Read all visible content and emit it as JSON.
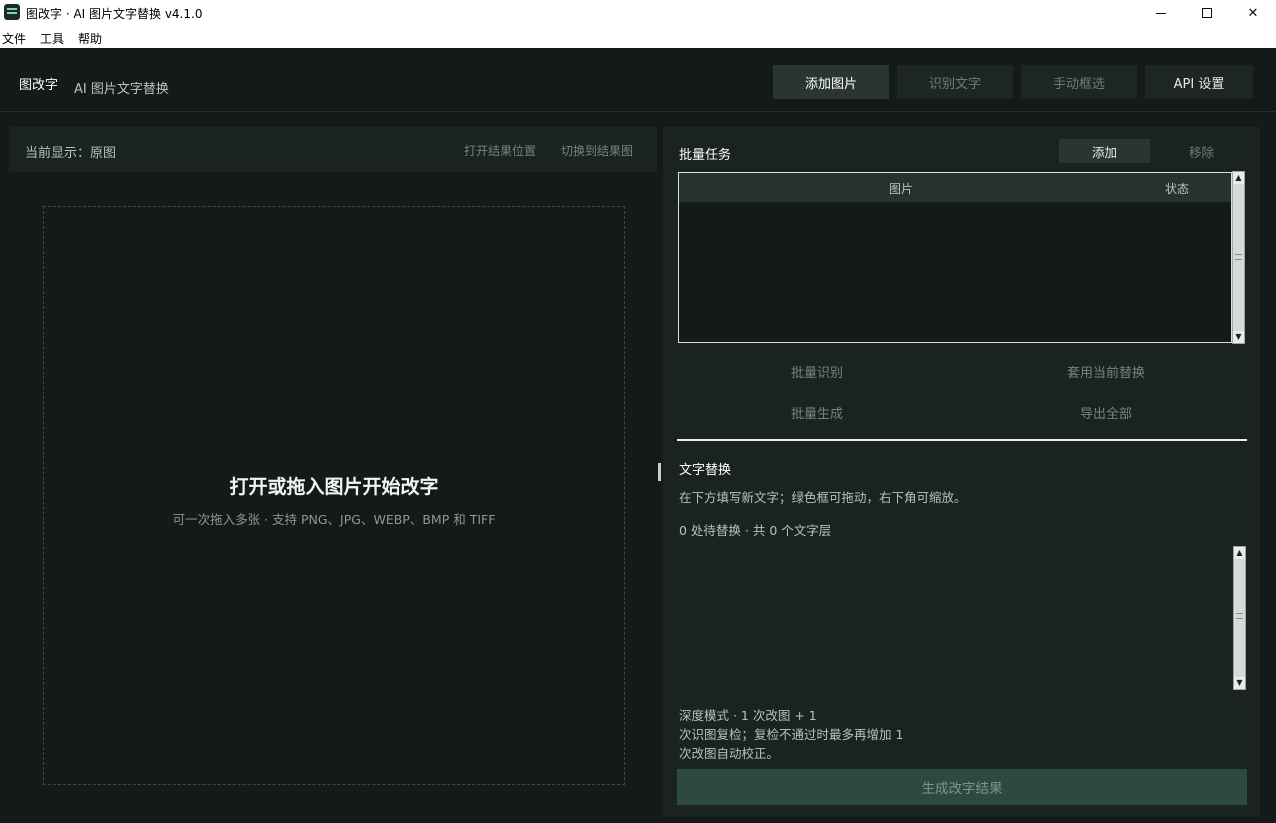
{
  "window": {
    "title": "图改字 · AI 图片文字替换  v4.1.0",
    "icons": {
      "minimize": "minimize-icon",
      "maximize": "maximize-icon",
      "close": "close-icon"
    },
    "close_glyph": "✕"
  },
  "menu": {
    "items": [
      "文件",
      "工具",
      "帮助"
    ]
  },
  "header": {
    "brand": "图改字",
    "subtitle": "AI 图片文字替换",
    "buttons": {
      "add_image": "添加图片",
      "recognize_text": "识别文字",
      "manual_select": "手动框选",
      "api_settings": "API 设置"
    }
  },
  "left": {
    "current_display": "当前显示：原图",
    "open_result_location": "打开结果位置",
    "switch_to_result": "切换到结果图",
    "dropzone": {
      "title": "打开或拖入图片开始改字",
      "subtitle": "可一次拖入多张 · 支持 PNG、JPG、WEBP、BMP 和 TIFF"
    }
  },
  "batch": {
    "title": "批量任务",
    "add": "添加",
    "remove": "移除",
    "columns": {
      "image": "图片",
      "status": "状态"
    },
    "actions": {
      "batch_recognize": "批量识别",
      "apply_current": "套用当前替换",
      "batch_generate": "批量生成",
      "export_all": "导出全部"
    }
  },
  "replace": {
    "title": "文字替换",
    "hint": "在下方填写新文字；绿色框可拖动，右下角可缩放。",
    "count": "0 处待替换 · 共 0 个文字层",
    "mode_lines": [
      "深度模式 · 1 次改图 + 1",
      "次识图复检；复检不通过时最多再增加 1",
      "次改图自动校正。"
    ],
    "generate": "生成改字结果"
  },
  "scroll_glyphs": {
    "up": "▲",
    "down": "▼"
  }
}
